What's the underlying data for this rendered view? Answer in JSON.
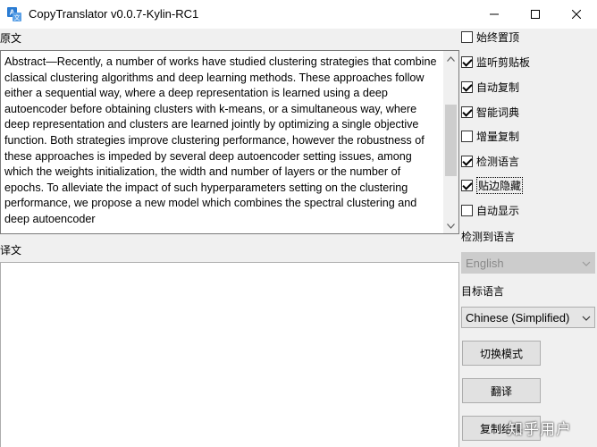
{
  "window": {
    "title": "CopyTranslator v0.0.7-Kylin-RC1"
  },
  "source": {
    "label": "原文",
    "text": "Abstract—Recently, a number of works have studied clustering strategies that combine classical clustering algorithms and deep learning methods. These approaches follow either a sequential way, where a deep representation is learned using a deep autoencoder before obtaining clusters with k-means, or a simultaneous way, where deep representation and clusters are learned jointly by optimizing a single objective function. Both strategies improve clustering performance, however the robustness of these approaches is impeded by several deep autoencoder setting issues, among which the weights initialization, the width and number of layers or the number of epochs. To alleviate the impact of such hyperparameters setting on the clustering performance, we propose a new model which combines the spectral clustering and deep autoencoder"
  },
  "target": {
    "label": "译文",
    "text": ""
  },
  "options": [
    {
      "label": "始终置顶",
      "checked": false
    },
    {
      "label": "监听剪贴板",
      "checked": true
    },
    {
      "label": "自动复制",
      "checked": true
    },
    {
      "label": "智能词典",
      "checked": true
    },
    {
      "label": "增量复制",
      "checked": false
    },
    {
      "label": "检测语言",
      "checked": true
    },
    {
      "label": "贴边隐藏",
      "checked": true
    },
    {
      "label": "自动显示",
      "checked": false
    }
  ],
  "detect_language": {
    "label": "检测到语言",
    "value": "English"
  },
  "target_language": {
    "label": "目标语言",
    "value": "Chinese (Simplified)"
  },
  "buttons": {
    "switch_mode": "切换模式",
    "translate": "翻译",
    "copy": "复制结果"
  },
  "watermark": "知乎用户",
  "colors": {
    "app_icon": "#2b7cd3",
    "disabled_combo": "#cccccc"
  }
}
